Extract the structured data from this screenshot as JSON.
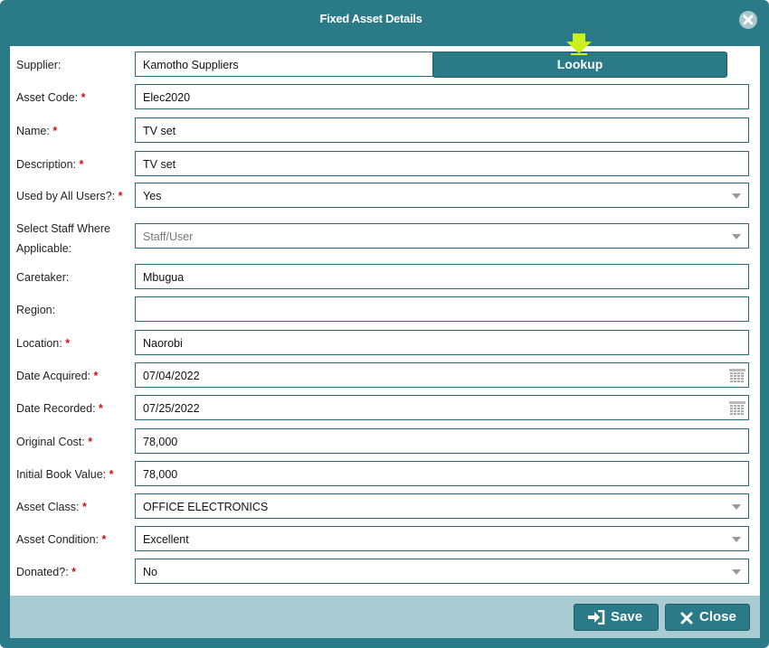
{
  "dialog": {
    "title": "Fixed Asset Details"
  },
  "supplier": {
    "label": "Supplier:",
    "value": "Kamotho Suppliers",
    "lookup_label": "Lookup"
  },
  "fields": [
    {
      "label": "Asset Code:",
      "required": "*",
      "value": "Elec2020"
    },
    {
      "label": "Name:",
      "required": "*",
      "value": "TV set"
    },
    {
      "label": "Description:",
      "required": "*",
      "value": "TV set"
    },
    {
      "label": "Used by All Users?:",
      "required": "*",
      "value": "Yes"
    },
    {
      "label1": "Select Staff Where",
      "label2": "Applicable:",
      "placeholder": "Staff/User"
    },
    {
      "label": "Caretaker:",
      "value": "Mbugua"
    },
    {
      "label": "Region:",
      "value": ""
    },
    {
      "label": "Location:",
      "required": "*",
      "value": "Naorobi"
    },
    {
      "label": "Date Acquired:",
      "required": "*",
      "value": "07/04/2022"
    },
    {
      "label": "Date Recorded:",
      "required": "*",
      "value": "07/25/2022"
    },
    {
      "label": "Original Cost:",
      "required": "*",
      "value": "78,000"
    },
    {
      "label": "Initial Book Value:",
      "required": "*",
      "value": "78,000"
    },
    {
      "label": "Asset Class:",
      "required": "*",
      "value": "OFFICE ELECTRONICS"
    },
    {
      "label": "Asset Condition:",
      "required": "*",
      "value": "Excellent"
    },
    {
      "label": "Donated?:",
      "required": "*",
      "value": "No"
    }
  ],
  "footer": {
    "save_label": "Save",
    "close_label": "Close"
  },
  "colors": {
    "header": "#2a7a88",
    "footer": "#a9ccd2",
    "required": "#d01010",
    "pointer": "#ccf01a"
  },
  "icons": [
    "close-icon",
    "pointer-arrow-icon",
    "calendar-icon",
    "dropdown-arrow-icon",
    "sign-in-icon",
    "x-icon"
  ]
}
